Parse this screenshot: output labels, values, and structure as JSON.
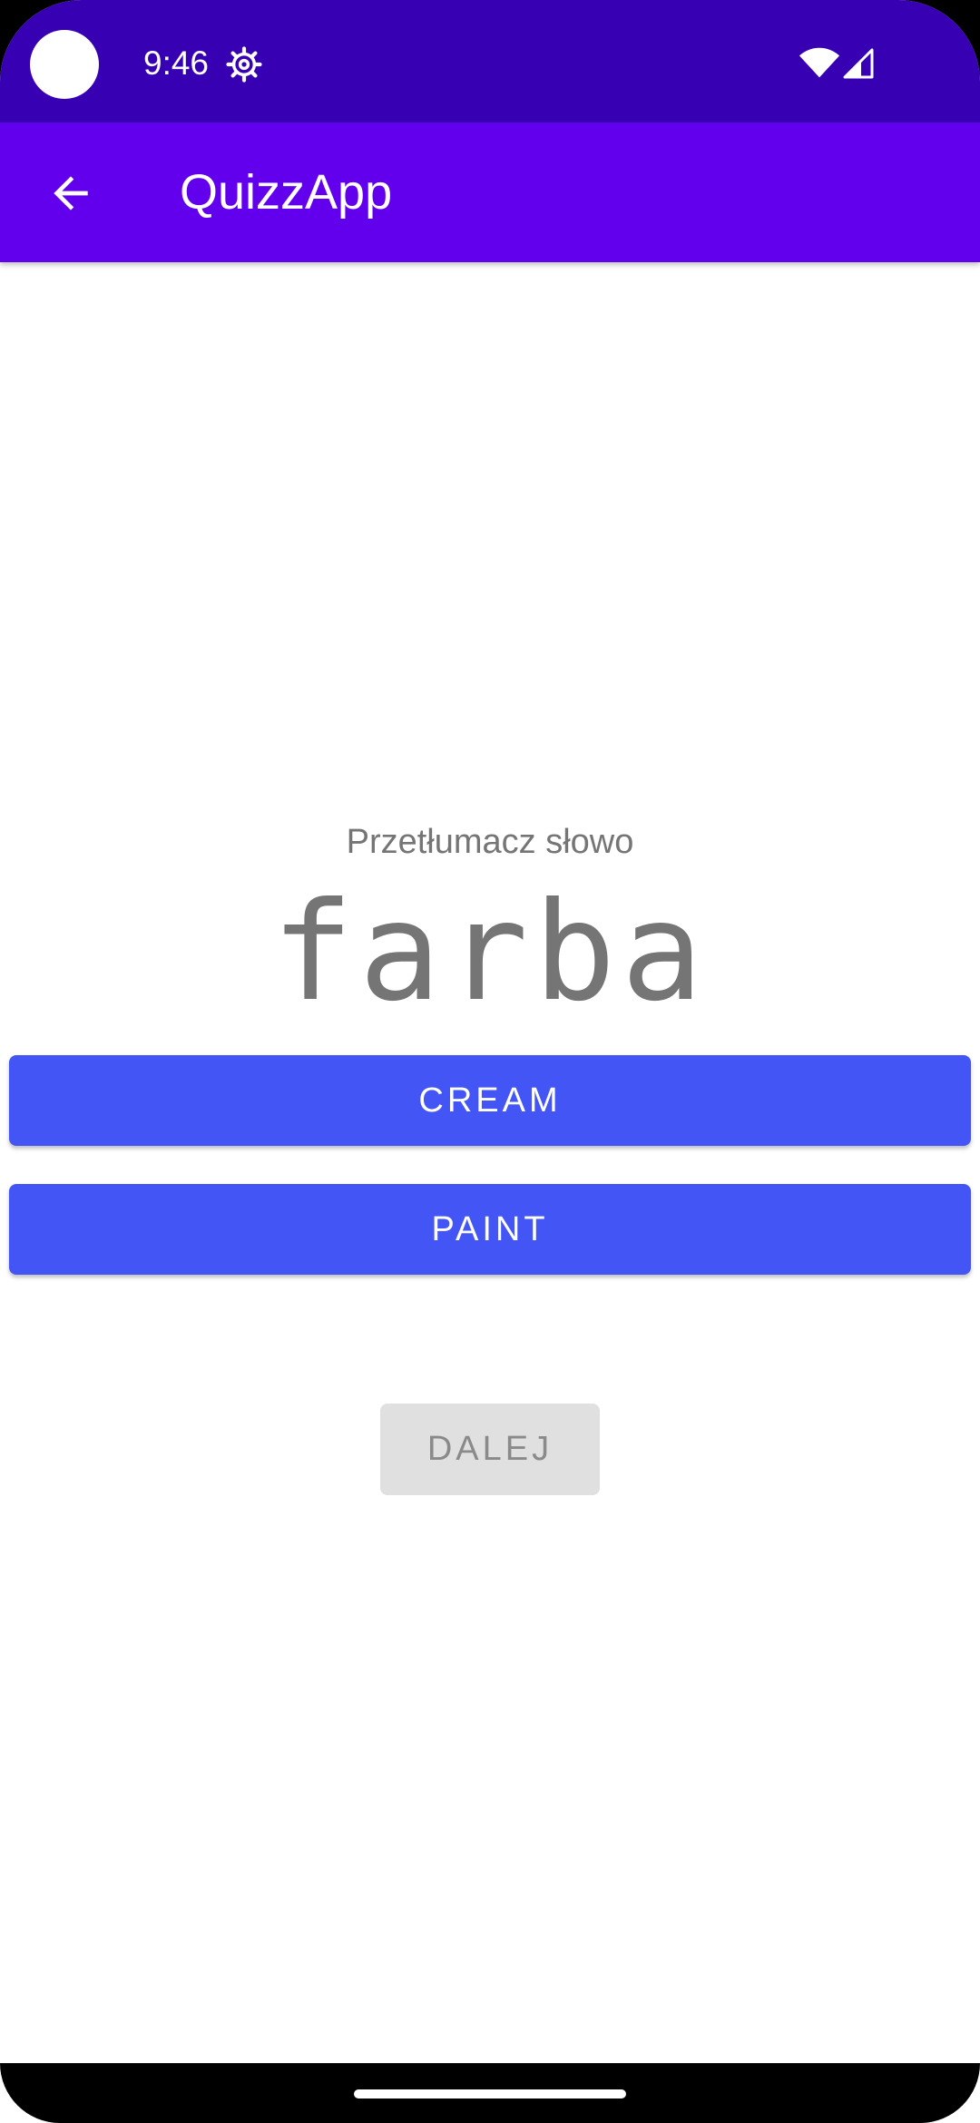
{
  "status_bar": {
    "time": "9:46",
    "icons": [
      "settings-icon",
      "wifi-icon",
      "signal-icon"
    ]
  },
  "app_bar": {
    "title": "QuizzApp",
    "back_icon": "arrow-back-icon"
  },
  "quiz": {
    "prompt": "Przetłumacz słowo",
    "word": "farba",
    "answers": [
      "CREAM",
      "PAINT"
    ],
    "next_label": "DALEJ"
  },
  "colors": {
    "status_bar": "#3700b3",
    "app_bar": "#6200ee",
    "answer_button": "#4355f5",
    "next_button_disabled": "#e0e0e0",
    "text_secondary": "#757575"
  }
}
